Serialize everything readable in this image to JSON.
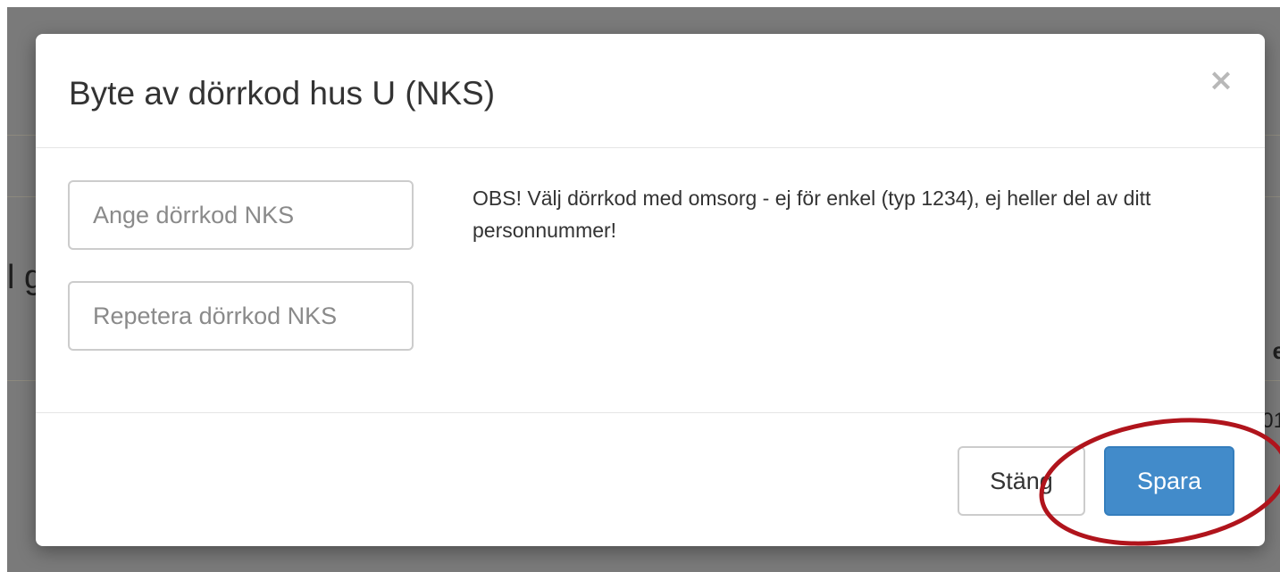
{
  "background": {
    "left_fragment": "l g",
    "right_fragment_1": "e",
    "right_fragment_2": "01"
  },
  "modal": {
    "title": "Byte av dörrkod hus U (NKS)",
    "close_symbol": "×",
    "inputs": {
      "door_code_placeholder": "Ange dörrkod NKS",
      "door_code_value": "",
      "repeat_code_placeholder": "Repetera dörrkod NKS",
      "repeat_code_value": ""
    },
    "notice": "OBS! Välj dörrkod med omsorg - ej för enkel (typ 1234), ej heller del av ditt personnummer!",
    "buttons": {
      "close_label": "Stäng",
      "save_label": "Spara"
    }
  },
  "colors": {
    "primary": "#428bca",
    "annotation": "#b0141c",
    "backdrop": "#7a7a7a"
  },
  "icons": {
    "close": "close-icon"
  }
}
